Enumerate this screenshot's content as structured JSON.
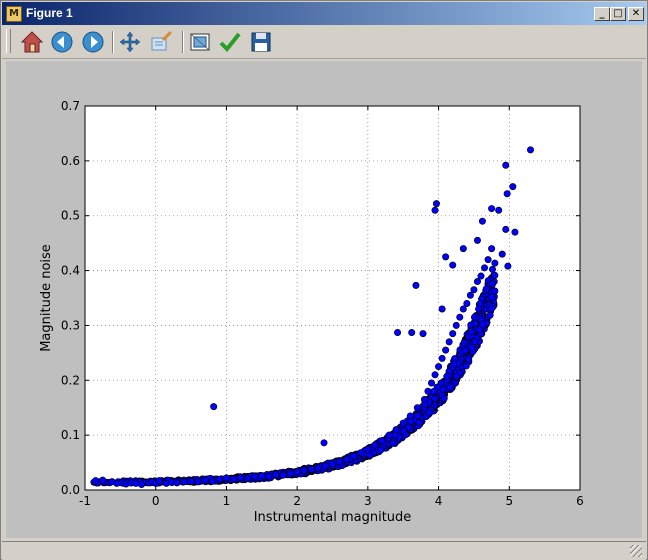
{
  "window": {
    "title": "Figure 1",
    "app_icon": "matplotlib-icon",
    "controls": [
      "minimize-icon",
      "maximize-icon",
      "close-icon"
    ]
  },
  "toolbar": {
    "buttons": [
      {
        "name": "home",
        "icon": "home-icon"
      },
      {
        "name": "back",
        "icon": "back-arrow-icon"
      },
      {
        "name": "forward",
        "icon": "forward-arrow-icon"
      },
      {
        "name": "pan",
        "icon": "pan-arrows-icon"
      },
      {
        "name": "zoom",
        "icon": "zoom-to-rect-icon"
      },
      {
        "name": "subplots",
        "icon": "configure-subplots-icon"
      },
      {
        "name": "edit",
        "icon": "checkmark-icon"
      },
      {
        "name": "save",
        "icon": "floppy-disk-icon"
      }
    ]
  },
  "colors": {
    "marker_fill": "#0000ff",
    "marker_edge": "#000000",
    "canvas_bg": "#bfbfbf",
    "title_gradient": [
      "#0a246a",
      "#a6caf0"
    ]
  },
  "chart_data": {
    "type": "scatter",
    "xlabel": "Instrumental magnitude",
    "ylabel": "Magnitude noise",
    "xlim": [
      -1,
      6
    ],
    "ylim": [
      0,
      0.7
    ],
    "xticks": [
      "-1",
      "0",
      "1",
      "2",
      "3",
      "4",
      "5",
      "6"
    ],
    "yticks": [
      "0.0",
      "0.1",
      "0.2",
      "0.3",
      "0.4",
      "0.5",
      "0.6",
      "0.7"
    ],
    "grid": true,
    "trend": {
      "model": "noise = 0.0125 + 0.0025 * exp(1.05 * (x - 0.05))",
      "x_range": [
        -0.9,
        4.8
      ]
    },
    "points": [
      [
        -0.85,
        0.017
      ],
      [
        -0.75,
        0.018
      ],
      [
        -0.62,
        0.015
      ],
      [
        -0.55,
        0.012
      ],
      [
        -0.48,
        0.013
      ],
      [
        -0.42,
        0.011
      ],
      [
        -0.35,
        0.013
      ],
      [
        -0.28,
        0.012
      ],
      [
        -0.2,
        0.01
      ],
      [
        -0.1,
        0.013
      ],
      [
        -0.05,
        0.015
      ],
      [
        0.0,
        0.012
      ],
      [
        0.05,
        0.017
      ],
      [
        0.15,
        0.012
      ],
      [
        0.22,
        0.014
      ],
      [
        0.3,
        0.013
      ],
      [
        0.4,
        0.015
      ],
      [
        0.5,
        0.016
      ],
      [
        0.6,
        0.015
      ],
      [
        0.7,
        0.018
      ],
      [
        0.8,
        0.016
      ],
      [
        0.9,
        0.019
      ],
      [
        1.0,
        0.022
      ],
      [
        1.1,
        0.02
      ],
      [
        1.2,
        0.023
      ],
      [
        1.3,
        0.021
      ],
      [
        1.4,
        0.024
      ],
      [
        1.5,
        0.026
      ],
      [
        1.6,
        0.025
      ],
      [
        1.7,
        0.028
      ],
      [
        1.8,
        0.027
      ],
      [
        1.9,
        0.03
      ],
      [
        2.0,
        0.033
      ],
      [
        2.1,
        0.035
      ],
      [
        2.2,
        0.038
      ],
      [
        2.3,
        0.04
      ],
      [
        2.4,
        0.044
      ],
      [
        2.5,
        0.048
      ],
      [
        2.6,
        0.052
      ],
      [
        2.7,
        0.056
      ],
      [
        2.8,
        0.062
      ],
      [
        2.9,
        0.068
      ],
      [
        3.0,
        0.074
      ],
      [
        3.1,
        0.082
      ],
      [
        3.2,
        0.09
      ],
      [
        3.3,
        0.1
      ],
      [
        3.4,
        0.11
      ],
      [
        3.5,
        0.122
      ],
      [
        3.6,
        0.135
      ],
      [
        3.7,
        0.15
      ],
      [
        3.8,
        0.165
      ],
      [
        3.85,
        0.18
      ],
      [
        3.9,
        0.195
      ],
      [
        3.95,
        0.21
      ],
      [
        4.0,
        0.225
      ],
      [
        4.05,
        0.24
      ],
      [
        4.1,
        0.255
      ],
      [
        4.15,
        0.27
      ],
      [
        4.2,
        0.285
      ],
      [
        4.25,
        0.3
      ],
      [
        4.3,
        0.315
      ],
      [
        4.35,
        0.33
      ],
      [
        4.4,
        0.34
      ],
      [
        4.45,
        0.355
      ],
      [
        4.5,
        0.365
      ],
      [
        4.55,
        0.38
      ],
      [
        4.6,
        0.39
      ],
      [
        4.65,
        0.405
      ],
      [
        4.7,
        0.42
      ],
      [
        4.75,
        0.44
      ],
      [
        0.82,
        0.152
      ],
      [
        2.38,
        0.086
      ],
      [
        3.42,
        0.287
      ],
      [
        3.62,
        0.287
      ],
      [
        3.68,
        0.373
      ],
      [
        3.78,
        0.285
      ],
      [
        3.95,
        0.51
      ],
      [
        3.97,
        0.522
      ],
      [
        4.1,
        0.425
      ],
      [
        4.05,
        0.33
      ],
      [
        4.2,
        0.41
      ],
      [
        4.35,
        0.44
      ],
      [
        4.55,
        0.455
      ],
      [
        4.62,
        0.49
      ],
      [
        4.75,
        0.513
      ],
      [
        4.85,
        0.51
      ],
      [
        4.9,
        0.43
      ],
      [
        4.95,
        0.475
      ],
      [
        4.95,
        0.592
      ],
      [
        4.97,
        0.54
      ],
      [
        5.05,
        0.553
      ],
      [
        5.08,
        0.47
      ],
      [
        4.98,
        0.408
      ],
      [
        5.3,
        0.62
      ]
    ]
  }
}
